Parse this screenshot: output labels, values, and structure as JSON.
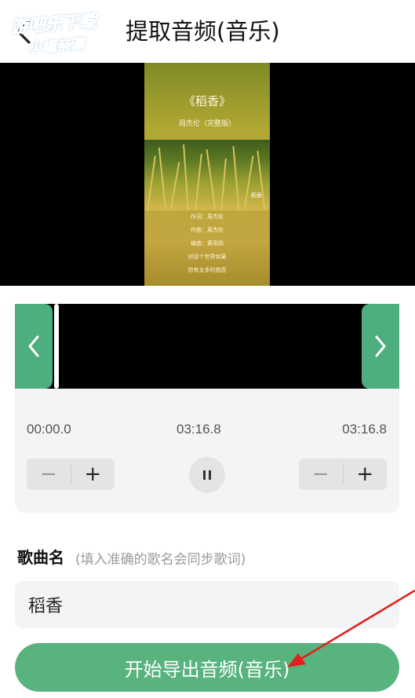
{
  "header": {
    "title": "提取音频(音乐)",
    "watermark_line1": "游吧乐下载",
    "watermark_line2": "小编亲测"
  },
  "video": {
    "poster_title": "《稻香》",
    "poster_subtitle": "周杰伦（完整版）",
    "photo_tag": "稻香",
    "credits": [
      "作词：周杰伦",
      "作曲：周杰伦",
      "编曲：黄雨勋",
      "对这个世界如果",
      "你有太多的抱怨"
    ]
  },
  "editor": {
    "start_time": "00:00.0",
    "current_time": "03:16.8",
    "end_time": "03:16.8",
    "minus_symbol": "−",
    "plus_symbol": "+"
  },
  "song": {
    "label": "歌曲名",
    "hint": "(填入准确的歌名会同步歌词)",
    "value": "稻香"
  },
  "export": {
    "label": "开始导出音频(音乐)"
  },
  "colors": {
    "accent_green": "#58b37e",
    "handle_green": "#4caf7d",
    "annotation_red": "#e0201c"
  }
}
